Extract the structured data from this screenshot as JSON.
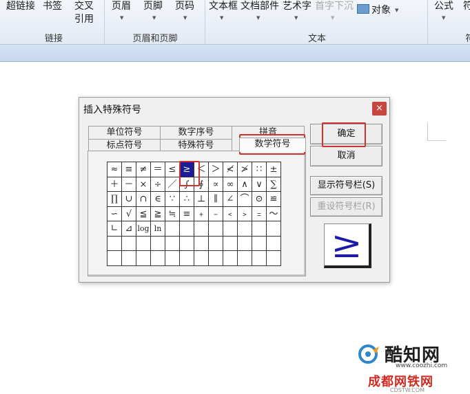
{
  "ribbon": {
    "hyperlink": "超链接",
    "bookmark": "书签",
    "crossref_line1": "交叉",
    "crossref_line2": "引用",
    "header": "页眉",
    "footer": "页脚",
    "page_number": "页码",
    "textbox": "文本框",
    "doc_parts": "文档部件",
    "wordart": "艺术字",
    "dropcap": "首字下沉",
    "object": "对象",
    "formula": "公式",
    "symbol_partial": "符",
    "groups": {
      "links": "链接",
      "header_footer": "页眉和页脚",
      "text": "文本",
      "symbols_partial": "符"
    }
  },
  "dialog": {
    "title": "插入特殊符号",
    "close": "×",
    "tabs_back": [
      "单位符号",
      "数字序号",
      "拼音"
    ],
    "tabs_front": [
      "标点符号",
      "特殊符号",
      "数学符号"
    ],
    "active_tab": "数学符号",
    "buttons": {
      "ok": "确定",
      "cancel": "取消",
      "show_bar": "显示符号栏(S)",
      "reset_bar": "重设符号栏(R)"
    },
    "symbols": [
      [
        "≈",
        "≡",
        "≠",
        "＝",
        "≤",
        "≥",
        "＜",
        "＞",
        "≮",
        "≯",
        "∷",
        "±"
      ],
      [
        "＋",
        "－",
        "×",
        "÷",
        "／",
        "∫",
        "∮",
        "∝",
        "∞",
        "∧",
        "∨",
        "∑"
      ],
      [
        "∏",
        "∪",
        "∩",
        "∈",
        "∵",
        "∴",
        "⊥",
        "∥",
        "∠",
        "⌒",
        "⊙",
        "≌"
      ],
      [
        "∽",
        "√",
        "≦",
        "≧",
        "≒",
        "≡",
        "﹢",
        "﹣",
        "﹤",
        "﹥",
        "﹦",
        "～"
      ],
      [
        "∟",
        "⊿",
        "log",
        "ln",
        "",
        "",
        "",
        "",
        "",
        "",
        "",
        ""
      ],
      [
        "",
        "",
        "",
        "",
        "",
        "",
        "",
        "",
        "",
        "",
        "",
        ""
      ],
      [
        "",
        "",
        "",
        "",
        "",
        "",
        "",
        "",
        "",
        "",
        "",
        ""
      ]
    ],
    "selected_symbol": "≥",
    "preview_symbol": "≥"
  },
  "watermark": {
    "name": "酷知网",
    "url": "www.coozhi.com",
    "site": "成都网铁网",
    "site_url": "CDSTW.COM"
  },
  "colors": {
    "highlight": "#d0312f",
    "selection": "#1c1c9a",
    "ribbon_bg": "#e3eaf4"
  }
}
